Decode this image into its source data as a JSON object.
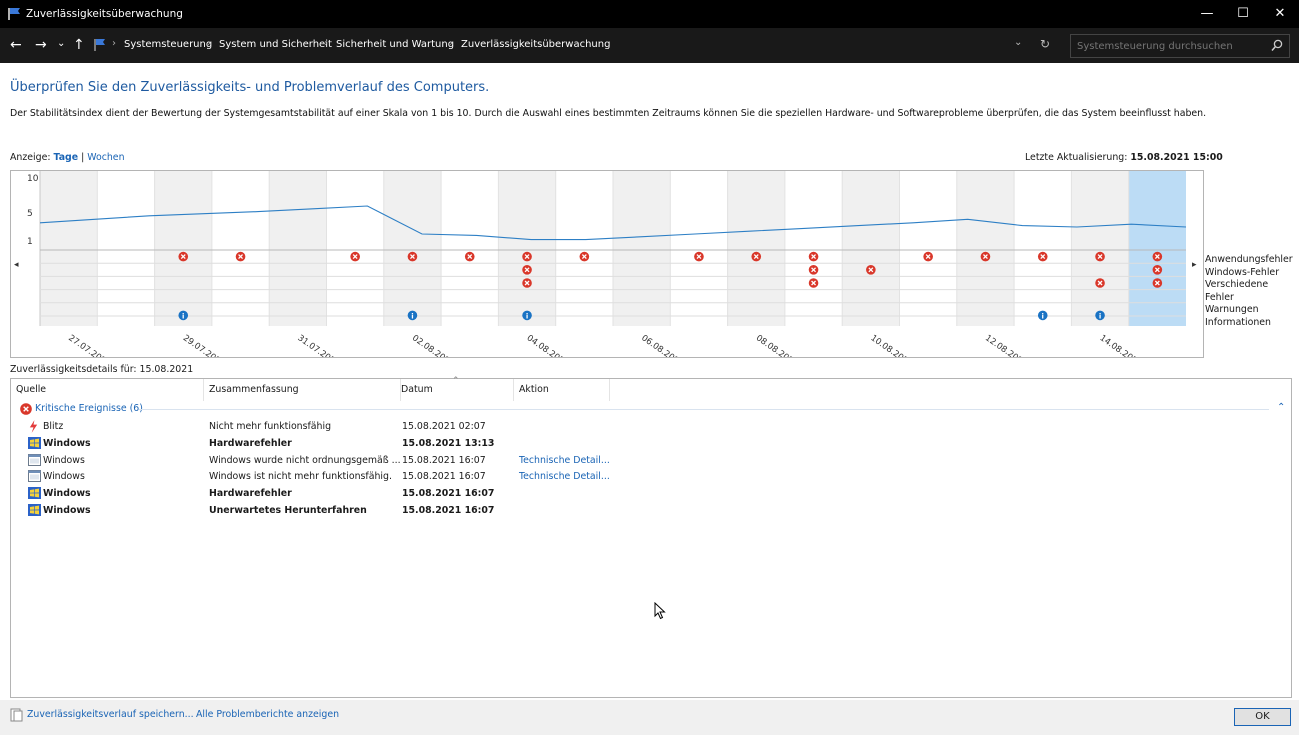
{
  "window": {
    "title": "Zuverlässigkeitsüberwachung",
    "minimize": "—",
    "maximize": "☐",
    "close": "✕"
  },
  "nav": {
    "back": "←",
    "forward": "→",
    "recent": "⌄",
    "up": "↑",
    "breadcrumbs": [
      "Systemsteuerung",
      "System und Sicherheit",
      "Sicherheit und Wartung",
      "Zuverlässigkeitsüberwachung"
    ],
    "dropdown": "⌄",
    "refresh": "↻",
    "search_placeholder": "Systemsteuerung durchsuchen"
  },
  "header": {
    "title": "Überprüfen Sie den Zuverlässigkeits- und Problemverlauf des Computers."
  },
  "description": "Der Stabilitätsindex dient der Bewertung der Systemgesamtstabilität auf einer Skala von 1 bis 10. Durch die Auswahl eines bestimmten Zeitraums können Sie die speziellen Hardware- und Softwareprobleme überprüfen, die das System beeinflusst haben.",
  "view": {
    "label": "Anzeige:",
    "days": "Tage",
    "separator": "|",
    "weeks": "Wochen"
  },
  "last_update": {
    "label": "Letzte Aktualisierung:",
    "value": "15.08.2021 15:00"
  },
  "chart_data": {
    "type": "line",
    "y_ticks": [
      "10",
      "5",
      "1"
    ],
    "ylim": [
      1,
      10
    ],
    "x_labels": [
      "27.07.2021",
      "29.07.2021",
      "31.07.2021",
      "02.08.2021",
      "04.08.2021",
      "06.08.2021",
      "08.08.2021",
      "10.08.2021",
      "12.08.2021",
      "14.08.2021"
    ],
    "columns": 20,
    "selected_column": 19,
    "stability_index": [
      3.6,
      4.1,
      4.6,
      4.9,
      5.2,
      5.6,
      6.0,
      2.0,
      1.8,
      1.2,
      1.2,
      1.6,
      2.0,
      2.4,
      2.8,
      3.2,
      3.6,
      4.1,
      3.2,
      3.0,
      3.4,
      3.0
    ],
    "rows": [
      "Anwendungsfehler",
      "Windows-Fehler",
      "Verschiedene Fehler",
      "Warnungen",
      "Informationen"
    ],
    "events": {
      "Anwendungsfehler": [
        2,
        3,
        5,
        6,
        7,
        8,
        9,
        11,
        12,
        13,
        15,
        16,
        17,
        18,
        19
      ],
      "Windows-Fehler": [
        8,
        13,
        14,
        19
      ],
      "Verschiedene Fehler": [
        8,
        13,
        18,
        19
      ],
      "Warnungen": [],
      "Informationen": [
        2,
        6,
        8,
        17,
        18
      ]
    },
    "scroll_left": "◂",
    "scroll_right": "▸"
  },
  "details": {
    "label": "Zuverlässigkeitsdetails für: 15.08.2021",
    "columns": [
      "Quelle",
      "Zusammenfassung",
      "Datum",
      "Aktion"
    ],
    "group": {
      "label": "Kritische Ereignisse (6)",
      "collapse": "⌃"
    },
    "rows": [
      {
        "source": "Blitz",
        "summary": "Nicht mehr funktionsfähig",
        "date": "15.08.2021 02:07",
        "action": "",
        "bold": false,
        "icon": "lightning-icon"
      },
      {
        "source": "Windows",
        "summary": "Hardwarefehler",
        "date": "15.08.2021 13:13",
        "action": "",
        "bold": true,
        "icon": "windows-logo-icon"
      },
      {
        "source": "Windows",
        "summary": "Windows wurde nicht ordnungsgemäß ...",
        "date": "15.08.2021 16:07",
        "action": "Technische Detail...",
        "bold": false,
        "icon": "window-app-icon"
      },
      {
        "source": "Windows",
        "summary": "Windows ist nicht mehr funktionsfähig.",
        "date": "15.08.2021 16:07",
        "action": "Technische Detail...",
        "bold": false,
        "icon": "window-app-icon"
      },
      {
        "source": "Windows",
        "summary": "Hardwarefehler",
        "date": "15.08.2021 16:07",
        "action": "",
        "bold": true,
        "icon": "windows-logo-icon"
      },
      {
        "source": "Windows",
        "summary": "Unerwartetes Herunterfahren",
        "date": "15.08.2021 16:07",
        "action": "",
        "bold": true,
        "icon": "windows-logo-icon"
      }
    ]
  },
  "footer": {
    "save": "Zuverlässigkeitsverlauf speichern...",
    "reports": "Alle Problemberichte anzeigen",
    "ok": "OK"
  },
  "colors": {
    "accent": "#1a64b5",
    "title": "#1e5aa0",
    "error": "#d9372a",
    "info": "#1a73c4",
    "selected": "#bcdcf5",
    "line": "#2d7fc5"
  }
}
